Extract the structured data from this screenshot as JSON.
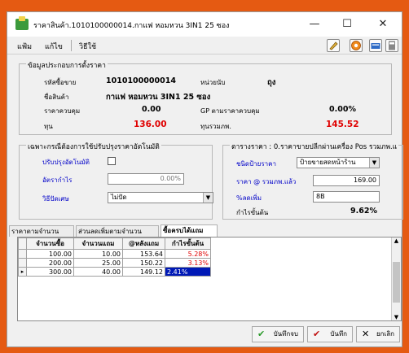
{
  "window": {
    "title": "ราคาสินค้า.1010100000014.กาแฟ หอมหวน 3IN1 25 ซอง",
    "controls": [
      "—",
      "☐",
      "✕"
    ]
  },
  "menu": {
    "items": [
      "แฟ้ม",
      "แก้ไข",
      "วิธีใช้"
    ]
  },
  "toolbar": {
    "icons": [
      "pencil-icon",
      "help-icon",
      "keyboard-icon",
      "calculator-icon"
    ]
  },
  "info": {
    "group_title": "ข้อมูลประกอบการตั้งราคา",
    "code_label": "รหัสซื้อขาย",
    "code_value": "1010100000014",
    "unit_label": "หน่วยนับ",
    "unit_value": "ถุง",
    "name_label": "ชื่อสินค้า",
    "name_value": "กาแฟ หอมหวน 3IN1 25 ซอง",
    "control_price_label": "ราคาควบคุม",
    "control_price_value": "0.00",
    "gp_label": "GP ตามราคาควบคุม",
    "gp_value": "0.00%",
    "cost_label": "ทุน",
    "cost_value": "136.00",
    "cost_vat_label": "ทุนรวมภพ.",
    "cost_vat_value": "145.52"
  },
  "auto": {
    "group_title": "เฉพาะกรณีต้องการใช้ปรับปรุงราคาอัตโนมัติ",
    "adjust_label": "ปรับปรุงอัตโนมัติ",
    "profit_rate_label": "อัตรากำไร",
    "profit_rate_value": "0.00%",
    "rounding_label": "วิธีปัดเศษ",
    "rounding_value": "ไม่ปัด"
  },
  "price": {
    "group_title": "ตารางราคา : 0.ราคาขายปลีกผ่านเครื่อง Pos รวมภพ.แ",
    "label_type_label": "ชนิดป้ายราคา",
    "label_type_value": "ป้ายขายสดหน้าร้าน",
    "price_label": "ราคา @ รวมภพ.แล้ว",
    "price_value": "169.00",
    "discount_label": "%ลดเพิ่ม",
    "discount_value": "8B",
    "profit_label": "กำไรขั้นต้น",
    "profit_value": "9.62%"
  },
  "tabs": [
    "ราคาตามจำนวน",
    "ส่วนลดเพิ่มตามจำนวน",
    "ซื้อครบได้แถม"
  ],
  "grid": {
    "headers": [
      "จำนวนซื้อ",
      "จำนวนแถม",
      "@หลังแถม",
      "กำไรขั้นต้น"
    ],
    "rows": [
      [
        "100.00",
        "10.00",
        "153.64",
        "5.28%"
      ],
      [
        "200.00",
        "25.00",
        "150.22",
        "3.13%"
      ],
      [
        "300.00",
        "40.00",
        "149.12",
        "2.41%"
      ]
    ],
    "current_indicator": "▸"
  },
  "buttons": {
    "save_print": "บันทึกจบ",
    "save": "บันทึก",
    "cancel": "ยกเลิก"
  },
  "colors": {
    "red": "#e00000",
    "blue": "#0000c8",
    "selection": "#0019b6",
    "frame": "#e55a12"
  }
}
